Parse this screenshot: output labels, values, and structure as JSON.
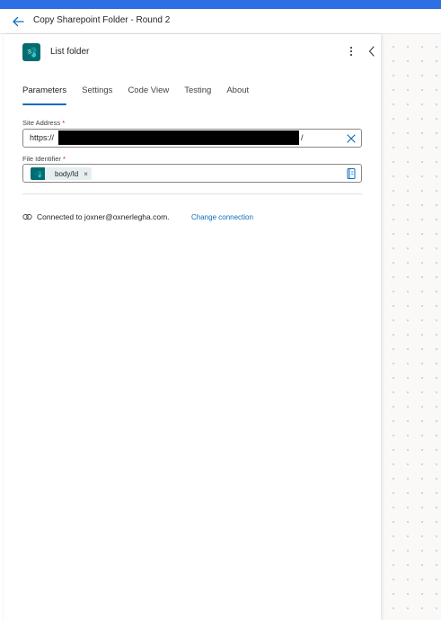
{
  "header": {
    "title": "Copy Sharepoint Folder - Round 2"
  },
  "action": {
    "title": "List folder",
    "icon": "sharepoint-icon",
    "icon_color": "#036c70"
  },
  "tabs": [
    {
      "label": "Parameters",
      "active": true
    },
    {
      "label": "Settings",
      "active": false
    },
    {
      "label": "Code View",
      "active": false
    },
    {
      "label": "Testing",
      "active": false
    },
    {
      "label": "About",
      "active": false
    }
  ],
  "fields": {
    "site_address": {
      "label": "Site Address",
      "required_mark": "*",
      "value_prefix": "https://",
      "value_suffix": "/"
    },
    "file_identifier": {
      "label": "File Identifier",
      "required_mark": "*",
      "token_label": "body/Id",
      "token_remove": "×"
    }
  },
  "connection": {
    "text": "Connected to joxner@oxnerlegha.com.",
    "change_label": "Change connection"
  },
  "colors": {
    "accent": "#0f6cbd",
    "top_bar": "#2f6fe4",
    "required": "#c50f1f"
  }
}
